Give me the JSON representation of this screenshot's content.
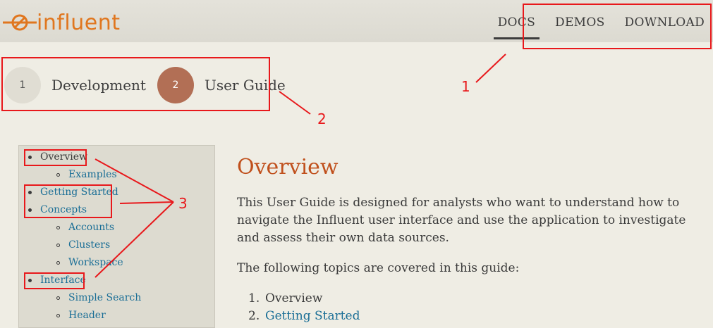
{
  "header": {
    "logo_text": "influent",
    "nav": [
      {
        "label": "DOCS",
        "active": true
      },
      {
        "label": "DEMOS",
        "active": false
      },
      {
        "label": "DOWNLOAD",
        "active": false
      }
    ]
  },
  "steps": [
    {
      "number": "1",
      "label": "Development"
    },
    {
      "number": "2",
      "label": "User Guide"
    }
  ],
  "annotations": {
    "n1": "1",
    "n2": "2",
    "n3": "3"
  },
  "sidebar": {
    "items": [
      {
        "label": "Overview",
        "level": 1,
        "link": false
      },
      {
        "label": "Examples",
        "level": 2,
        "link": true
      },
      {
        "label": "Getting Started",
        "level": 1,
        "link": true
      },
      {
        "label": "Concepts",
        "level": 1,
        "link": true
      },
      {
        "label": "Accounts",
        "level": 2,
        "link": true
      },
      {
        "label": "Clusters",
        "level": 2,
        "link": true
      },
      {
        "label": "Workspace",
        "level": 2,
        "link": true
      },
      {
        "label": "Interface",
        "level": 1,
        "link": true
      },
      {
        "label": "Simple Search",
        "level": 2,
        "link": true
      },
      {
        "label": "Header",
        "level": 2,
        "link": true
      }
    ]
  },
  "content": {
    "title": "Overview",
    "intro": "This User Guide is designed for analysts who want to understand how to navigate the Influent user interface and use the application to investigate and assess their own data sources.",
    "topics_intro": "The following topics are covered in this guide:",
    "topics": [
      {
        "num": "1.",
        "label": "Overview",
        "link": false
      },
      {
        "num": "2.",
        "label": "Getting Started",
        "link": true
      }
    ]
  },
  "colors": {
    "accent": "#e0761e",
    "heading": "#c0501c",
    "link": "#1a6e96",
    "annotation": "#e8181b",
    "active_step": "#b26f55"
  }
}
